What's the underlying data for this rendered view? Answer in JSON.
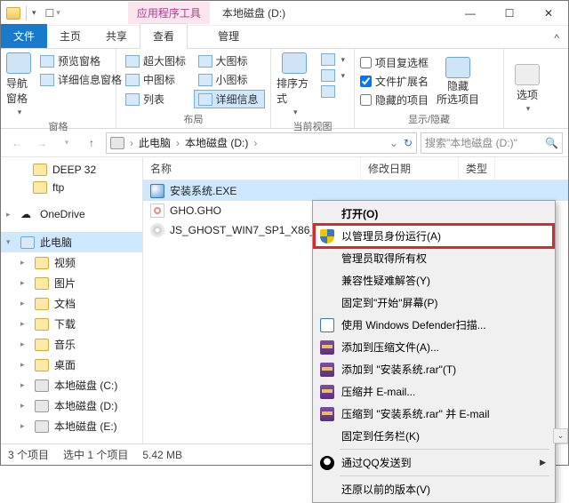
{
  "titlebar": {
    "tool_tab": "应用程序工具",
    "title": "本地磁盘 (D:)"
  },
  "tabs": {
    "file": "文件",
    "home": "主页",
    "share": "共享",
    "view": "查看",
    "manage": "管理"
  },
  "ribbon": {
    "nav_pane": "导航窗格",
    "preview_pane": "预览窗格",
    "detail_pane": "详细信息窗格",
    "extra_large": "超大图标",
    "large": "大图标",
    "medium": "中图标",
    "small": "小图标",
    "list": "列表",
    "details": "详细信息",
    "sort": "排序方式",
    "item_checkboxes": "项目复选框",
    "file_ext": "文件扩展名",
    "hidden_items": "隐藏的项目",
    "hide_selected": "隐藏\n所选项目",
    "options": "选项",
    "g_pane": "窗格",
    "g_layout": "布局",
    "g_current": "当前视图",
    "g_showhide": "显示/隐藏"
  },
  "address": {
    "this_pc": "此电脑",
    "drive": "本地磁盘 (D:)",
    "search_placeholder": "搜索\"本地磁盘 (D:)\""
  },
  "tree": {
    "deep32": "DEEP 32",
    "ftp": "ftp",
    "onedrive": "OneDrive",
    "this_pc": "此电脑",
    "videos": "视频",
    "pictures": "图片",
    "documents": "文档",
    "downloads": "下载",
    "music": "音乐",
    "desktop": "桌面",
    "drive_c": "本地磁盘 (C:)",
    "drive_d": "本地磁盘 (D:)",
    "drive_e": "本地磁盘 (E:)"
  },
  "columns": {
    "name": "名称",
    "date": "修改日期",
    "type": "类型"
  },
  "files": [
    {
      "name": "安装系统.EXE",
      "kind": "exe"
    },
    {
      "name": "GHO.GHO",
      "kind": "gho"
    },
    {
      "name": "JS_GHOST_WIN7_SP1_X86_...",
      "kind": "iso"
    }
  ],
  "context_menu": {
    "open": "打开(O)",
    "run_as_admin": "以管理员身份运行(A)",
    "admin_ownership": "管理员取得所有权",
    "troubleshoot": "兼容性疑难解答(Y)",
    "pin_start": "固定到\"开始\"屏幕(P)",
    "defender": "使用 Windows Defender扫描...",
    "add_archive": "添加到压缩文件(A)...",
    "add_rar": "添加到 \"安装系统.rar\"(T)",
    "compress_email": "压缩并 E-mail...",
    "compress_rar_email": "压缩到 \"安装系统.rar\" 并 E-mail",
    "pin_taskbar": "固定到任务栏(K)",
    "qq_send": "通过QQ发送到",
    "restore_prev": "还原以前的版本(V)"
  },
  "status": {
    "items": "3 个项目",
    "selected": "选中 1 个项目",
    "size": "5.42 MB"
  }
}
